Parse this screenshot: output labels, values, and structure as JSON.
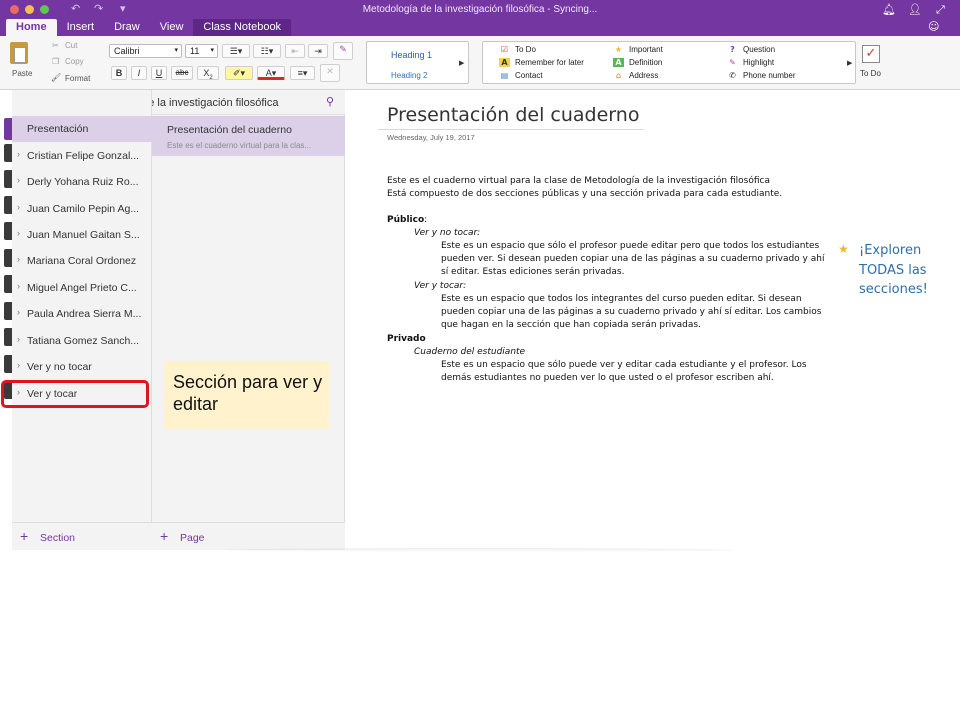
{
  "window": {
    "title": "Metodología de la investigación filosófica - Syncing...",
    "tabs": [
      "Home",
      "Insert",
      "Draw",
      "View",
      "Class Notebook"
    ]
  },
  "ribbon": {
    "paste": "Paste",
    "cut": "Cut",
    "copy": "Copy",
    "format": "Format",
    "font": "Calibri",
    "size": "11",
    "bold": "B",
    "italic": "I",
    "underline": "U",
    "strike": "abc",
    "subscript": "X",
    "styles": [
      "Heading 1",
      "Heading 2"
    ],
    "tags": [
      {
        "label": "To Do",
        "icon": "checkbox-icon"
      },
      {
        "label": "Remember for later",
        "icon": "letter-a-yellow-icon"
      },
      {
        "label": "Contact",
        "icon": "contact-card-icon"
      },
      {
        "label": "Important",
        "icon": "star-icon"
      },
      {
        "label": "Definition",
        "icon": "letter-a-green-icon"
      },
      {
        "label": "Address",
        "icon": "house-icon"
      },
      {
        "label": "Question",
        "icon": "question-icon"
      },
      {
        "label": "Highlight",
        "icon": "highlighter-icon"
      },
      {
        "label": "Phone number",
        "icon": "phone-icon"
      }
    ],
    "todo_big": "To Do"
  },
  "notebook": {
    "title": "Metodología de la investigación filosófica",
    "sections": [
      "Presentación",
      "Cristian Felipe Gonzal...",
      "Derly Yohana Ruiz Ro...",
      "Juan Camilo Pepin Ag...",
      "Juan Manuel Gaitan S...",
      "Mariana Coral Ordonez",
      "Miguel Angel Prieto C...",
      "Paula Andrea Sierra M...",
      "Tatiana Gomez Sanch...",
      "Ver y no tocar",
      "Ver y tocar"
    ],
    "add_section": "Section",
    "add_page": "Page"
  },
  "pages": [
    {
      "title": "Presentación del cuaderno",
      "preview": "Este es el cuaderno virtual para la clas..."
    }
  ],
  "callout": "Sección para ver y editar",
  "page": {
    "title": "Presentación del cuaderno",
    "date": "Wednesday, July 19, 2017",
    "intro1": "Este es el cuaderno virtual para la clase de Metodología de la investigación filosófica",
    "intro2": "Está compuesto de dos secciones públicas y una sección privada para cada estudiante.",
    "public_heading": "Público",
    "public_colon": ":",
    "sub1": "Ver y no tocar:",
    "sub1_text": "Este es un espacio que sólo el profesor puede editar pero que todos los estudiantes pueden ver. Si desean pueden copiar una de las páginas a su cuaderno privado y ahí sí editar. Estas ediciones serán privadas.",
    "sub2": "Ver y tocar:",
    "sub2_text": "Este es un espacio que todos los integrantes del curso pueden editar. Si desean pueden copiar una de las páginas a su cuaderno privado y ahí sí editar. Los cambios que hagan en la sección que han copiada serán privadas.",
    "private_heading": "Privado",
    "sub3": "Cuaderno del estudiante",
    "sub3_text": "Este es un espacio que sólo puede ver y editar cada estudiante y el profesor. Los demás estudiantes no pueden ver lo que usted o el profesor escriben ahí.",
    "side_note": "¡Exploren TODAS las secciones!"
  },
  "colors": {
    "accent": "#7436a0",
    "selected": "#dcd0e8",
    "callout": "#fff2cc",
    "highlight_border": "#e0141e",
    "side_note": "#2e6fa7"
  }
}
